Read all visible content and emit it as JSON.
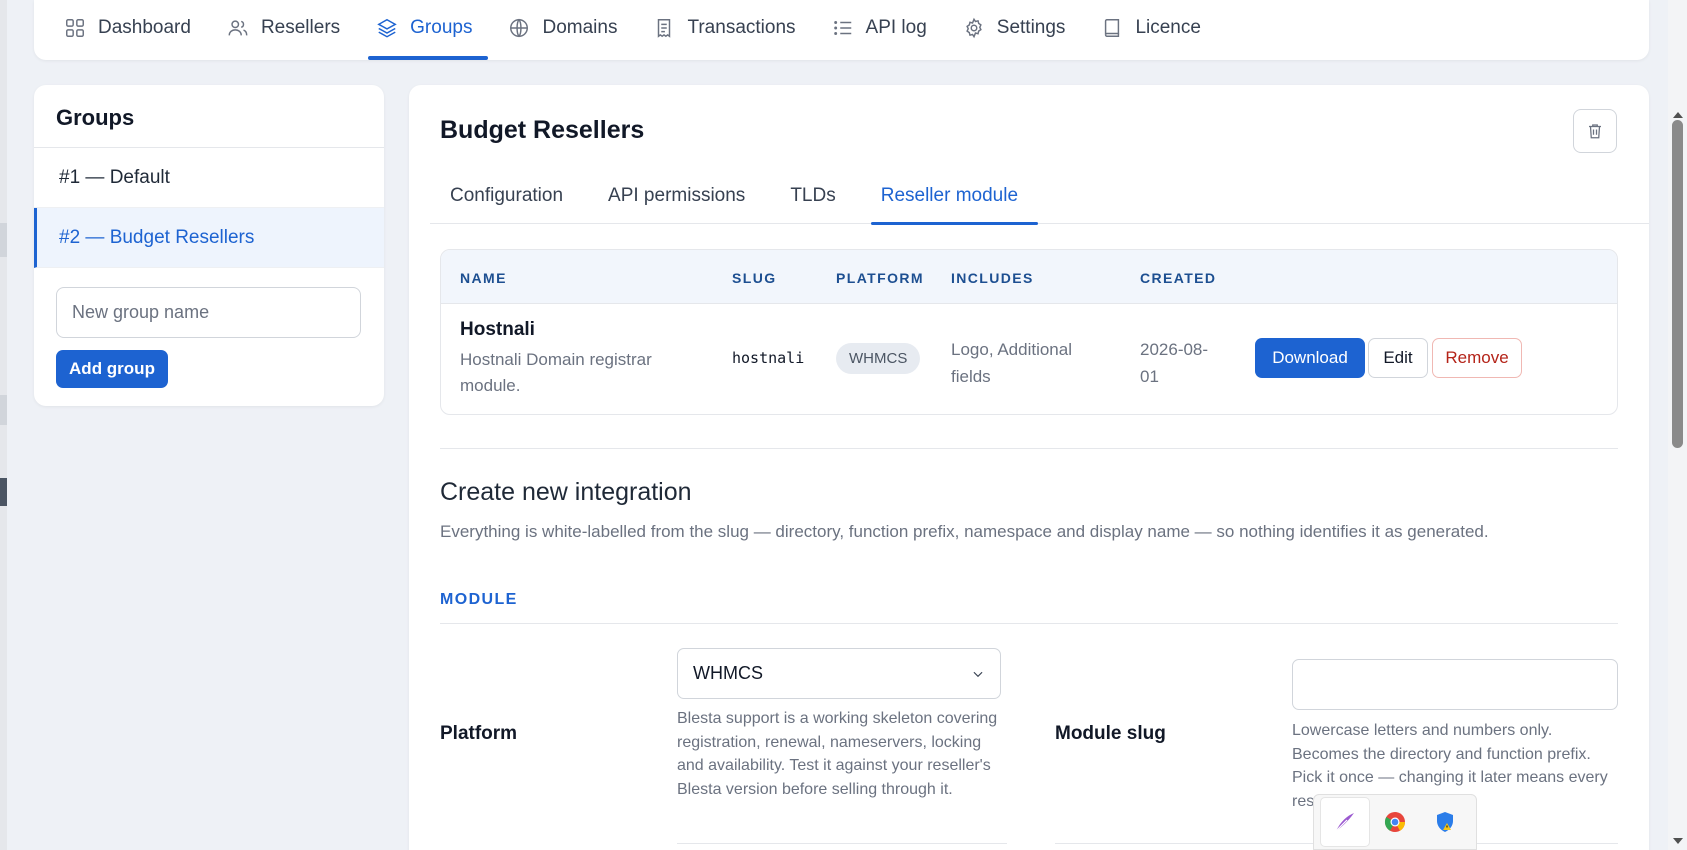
{
  "nav": {
    "items": [
      {
        "label": "Dashboard",
        "icon": "grid-icon"
      },
      {
        "label": "Resellers",
        "icon": "users-icon"
      },
      {
        "label": "Groups",
        "icon": "layers-icon",
        "active": true
      },
      {
        "label": "Domains",
        "icon": "globe-icon"
      },
      {
        "label": "Transactions",
        "icon": "receipt-icon"
      },
      {
        "label": "API log",
        "icon": "list-icon"
      },
      {
        "label": "Settings",
        "icon": "gear-icon"
      },
      {
        "label": "Licence",
        "icon": "book-icon"
      }
    ],
    "accent": "#1d63d1"
  },
  "groups": {
    "title": "Groups",
    "items": [
      {
        "label": "#1 — Default",
        "active": false
      },
      {
        "label": "#2 — Budget Resellers",
        "active": true
      }
    ],
    "new_group_placeholder": "New group name",
    "add_label": "Add group"
  },
  "main": {
    "title": "Budget Resellers",
    "tabs": [
      "Configuration",
      "API permissions",
      "TLDs",
      "Reseller module"
    ],
    "active_tab": "Reseller module",
    "table": {
      "headers": [
        "NAME",
        "SLUG",
        "PLATFORM",
        "INCLUDES",
        "CREATED"
      ],
      "rows": [
        {
          "name": "Hostnali",
          "description": "Hostnali Domain registrar module.",
          "slug": "hostnali",
          "platform": "WHMCS",
          "includes": "Logo, Additional fields",
          "created": "2026-08-01",
          "actions": {
            "download": "Download",
            "edit": "Edit",
            "remove": "Remove"
          }
        }
      ]
    },
    "create": {
      "title": "Create new integration",
      "description": "Everything is white-labelled from the slug — directory, function prefix, namespace and display name — so nothing identifies it as generated.",
      "section_label": "MODULE",
      "platform_label": "Platform",
      "platform_value": "WHMCS",
      "platform_help": "Blesta support is a working skeleton covering registration, renewal, nameservers, locking and availability. Test it against your reseller's Blesta version before selling through it.",
      "slug_label": "Module slug",
      "slug_value": "",
      "slug_help": "Lowercase letters and numbers only. Becomes the directory and function prefix. Pick it once — changing it later means every res"
    }
  },
  "tray": {
    "icons": [
      "feather-icon",
      "chrome-icon",
      "shield-warning-icon"
    ]
  }
}
